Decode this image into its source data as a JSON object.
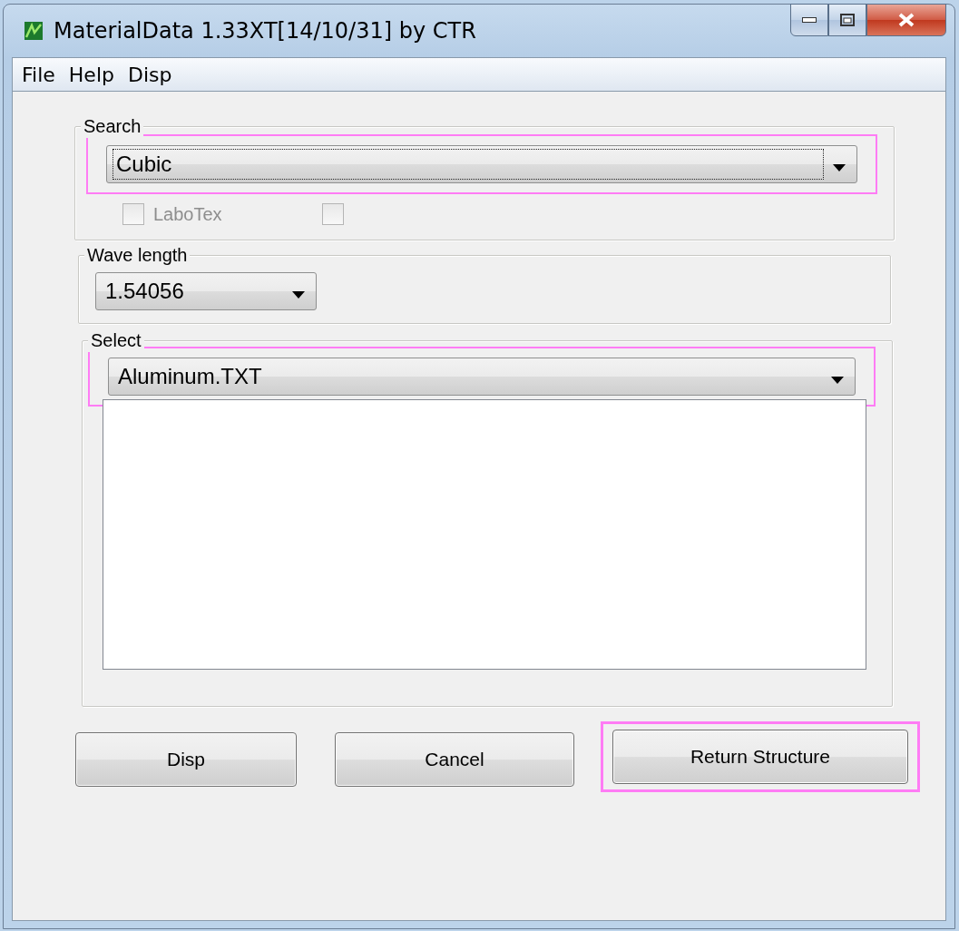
{
  "window": {
    "title": "MaterialData 1.33XT[14/10/31] by CTR"
  },
  "menu": [
    "File",
    "Help",
    "Disp"
  ],
  "search": {
    "title": "Search",
    "combo": {
      "value": "Cubic",
      "focused": true,
      "highlighted": true
    },
    "checkboxes": [
      {
        "label": "LaboTex",
        "checked": false,
        "disabled": true
      },
      {
        "checked": false,
        "disabled": true
      }
    ]
  },
  "wave_length": {
    "title": "Wave length",
    "combo": {
      "value": "1.54056",
      "focused": false,
      "highlighted": false
    }
  },
  "select": {
    "title": "Select",
    "combo": {
      "value": "Aluminum.TXT",
      "focused": false,
      "highlighted": true
    }
  },
  "buttons": [
    {
      "label": "Disp",
      "highlighted": false
    },
    {
      "label": "Cancel",
      "highlighted": false
    },
    {
      "label": "Return Structure",
      "highlighted": true
    }
  ]
}
